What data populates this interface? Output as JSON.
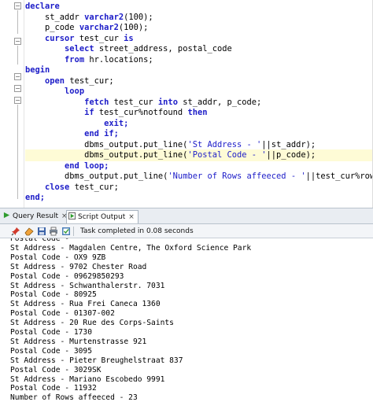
{
  "editor": {
    "lines": [
      [
        {
          "t": "declare",
          "c": "kw"
        }
      ],
      [
        {
          "t": "    st_addr ",
          "c": "txt"
        },
        {
          "t": "varchar2",
          "c": "kw"
        },
        {
          "t": "(100);",
          "c": "txt"
        }
      ],
      [
        {
          "t": "    p_code ",
          "c": "txt"
        },
        {
          "t": "varchar2",
          "c": "kw"
        },
        {
          "t": "(100);",
          "c": "txt"
        }
      ],
      [
        {
          "t": "    cursor ",
          "c": "kw"
        },
        {
          "t": "test_cur ",
          "c": "txt"
        },
        {
          "t": "is",
          "c": "kw"
        }
      ],
      [
        {
          "t": "        select ",
          "c": "kw"
        },
        {
          "t": "street_address, postal_code",
          "c": "txt"
        }
      ],
      [
        {
          "t": "        from ",
          "c": "kw"
        },
        {
          "t": "hr.locations;",
          "c": "txt"
        }
      ],
      [
        {
          "t": "begin",
          "c": "kw"
        }
      ],
      [
        {
          "t": "    open ",
          "c": "kw"
        },
        {
          "t": "test_cur;",
          "c": "txt"
        }
      ],
      [
        {
          "t": "        loop",
          "c": "kw"
        }
      ],
      [
        {
          "t": "            fetch ",
          "c": "kw"
        },
        {
          "t": "test_cur ",
          "c": "txt"
        },
        {
          "t": "into ",
          "c": "kw"
        },
        {
          "t": "st_addr, p_code;",
          "c": "txt"
        }
      ],
      [
        {
          "t": "            if ",
          "c": "kw"
        },
        {
          "t": "test_cur%notfound ",
          "c": "txt"
        },
        {
          "t": "then",
          "c": "kw"
        }
      ],
      [
        {
          "t": "                exit;",
          "c": "kw"
        }
      ],
      [
        {
          "t": "            end if;",
          "c": "kw"
        }
      ],
      [
        {
          "t": "            dbms_output.put_line(",
          "c": "txt"
        },
        {
          "t": "'St Address - '",
          "c": "str"
        },
        {
          "t": "||st_addr);",
          "c": "txt"
        }
      ],
      [
        {
          "t": "            dbms_output.put_line(",
          "c": "txt"
        },
        {
          "t": "'Postal Code - '",
          "c": "str"
        },
        {
          "t": "||p_code);",
          "c": "txt"
        }
      ],
      [
        {
          "t": "        end loop;",
          "c": "kw"
        }
      ],
      [
        {
          "t": "        dbms_output.put_line(",
          "c": "txt"
        },
        {
          "t": "'Number of Rows affeeced - '",
          "c": "str"
        },
        {
          "t": "||test_cur%rowcount);",
          "c": "txt"
        }
      ],
      [
        {
          "t": "    close ",
          "c": "kw"
        },
        {
          "t": "test_cur;",
          "c": "txt"
        }
      ],
      [
        {
          "t": "end;",
          "c": "kw"
        }
      ]
    ],
    "highlighted_line": 14
  },
  "tabs": {
    "query_result": "Query Result",
    "script_output": "Script Output",
    "close_symbol": "×"
  },
  "toolbar": {
    "status": "Task completed in 0.08 seconds"
  },
  "output": {
    "lines": [
      "Postal Code -",
      "St Address - Magdalen Centre, The Oxford Science Park",
      "Postal Code - OX9 9ZB",
      "St Address - 9702 Chester Road",
      "Postal Code - 09629850293",
      "St Address - Schwanthalerstr. 7031",
      "Postal Code - 80925",
      "St Address - Rua Frei Caneca 1360",
      "Postal Code - 01307-002",
      "St Address - 20 Rue des Corps-Saints",
      "Postal Code - 1730",
      "St Address - Murtenstrasse 921",
      "Postal Code - 3095",
      "St Address - Pieter Breughelstraat 837",
      "Postal Code - 3029SK",
      "St Address - Mariano Escobedo 9991",
      "Postal Code - 11932",
      "Number of Rows affeeced - 23"
    ]
  }
}
